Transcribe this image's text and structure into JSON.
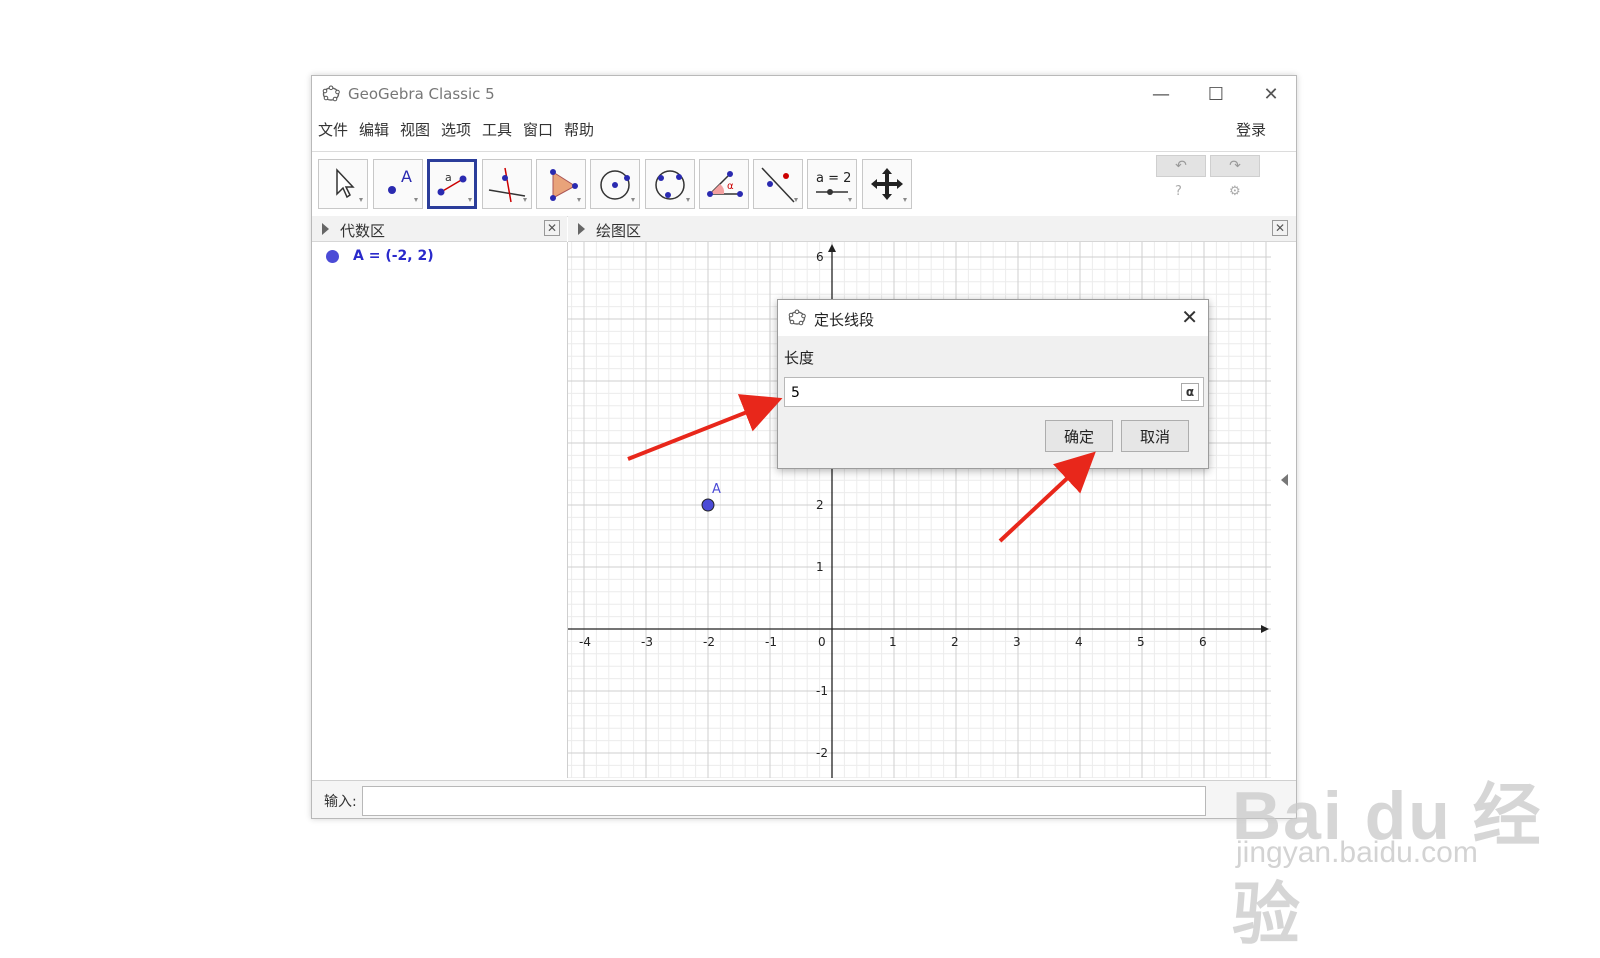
{
  "window": {
    "title": "GeoGebra Classic 5",
    "minimize": "—",
    "maximize": "☐",
    "close": "✕"
  },
  "menu": {
    "items": [
      "文件",
      "编辑",
      "视图",
      "选项",
      "工具",
      "窗口",
      "帮助"
    ],
    "login": "登录"
  },
  "toolbar": {
    "tools": [
      "move-tool",
      "point-tool",
      "segment-fixed-length-tool",
      "perpendicular-line-tool",
      "polygon-tool",
      "circle-tool",
      "conic-tool",
      "angle-tool",
      "reflect-tool",
      "slider-tool",
      "move-graphics-tool"
    ],
    "selected": "segment-fixed-length-tool",
    "slider_text": "a = 2",
    "undo_icon": "↶",
    "redo_icon": "↷",
    "help_icon": "?",
    "settings_icon": "⚙"
  },
  "algebra": {
    "title": "代数区",
    "items": [
      {
        "text": "A = (-2, 2)",
        "color": "#4b4bd6"
      }
    ]
  },
  "graphics": {
    "title": "绘图区",
    "x_ticks": [
      "-4",
      "-3",
      "-2",
      "-1",
      "0",
      "1",
      "2",
      "3",
      "4",
      "5",
      "6"
    ],
    "y_ticks": [
      "-2",
      "-1",
      "1",
      "2",
      "6"
    ],
    "point": {
      "label": "A",
      "x": -2,
      "y": 2
    }
  },
  "input": {
    "label": "输入:"
  },
  "dialog": {
    "title": "定长线段",
    "label": "长度",
    "value": "5",
    "alpha_button": "α",
    "ok": "确定",
    "cancel": "取消"
  },
  "watermark": {
    "brand": "Bai du 经验",
    "url": "jingyan.baidu.com"
  },
  "colors": {
    "accent": "#2b3d9a",
    "point": "#4b4bd6",
    "arrow": "#e8271b"
  }
}
